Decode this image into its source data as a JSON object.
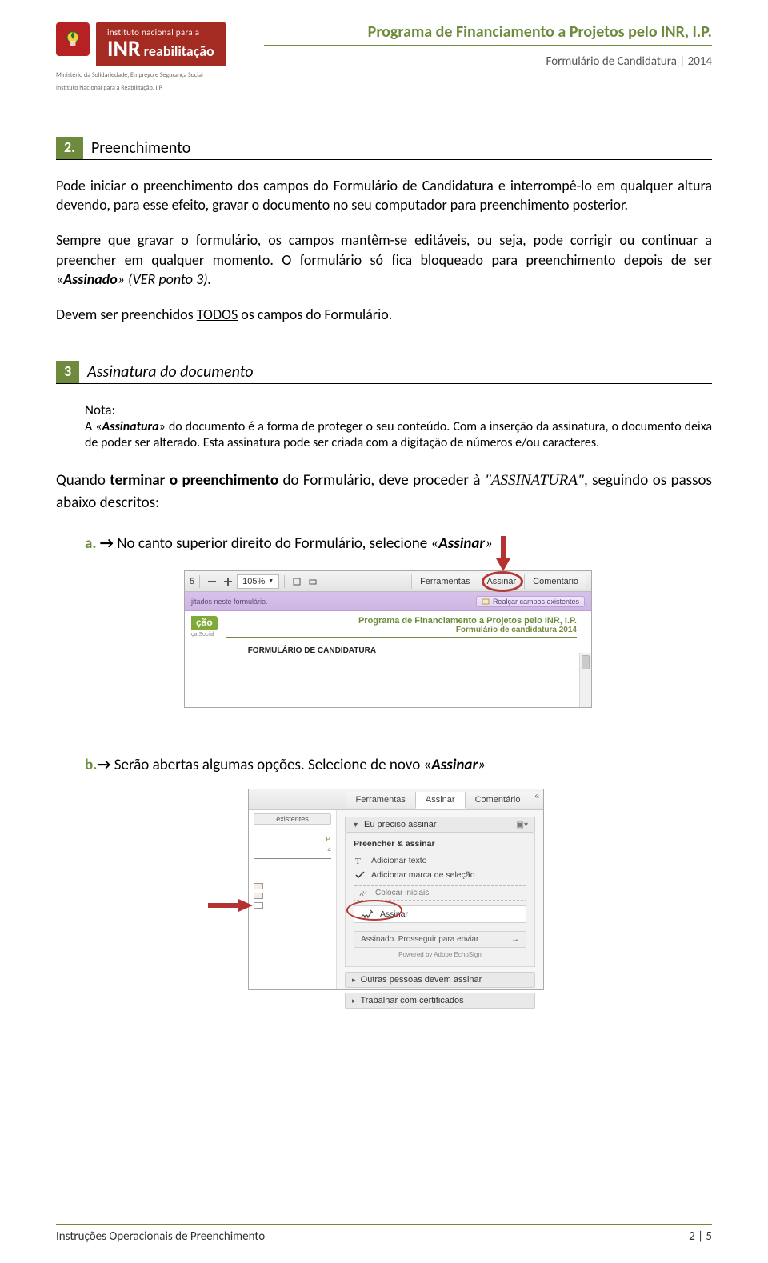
{
  "header": {
    "program_title": "Programa de Financiamento a Projetos pelo INR, I.P.",
    "subtitle": "Formulário de Candidatura | 2014",
    "brand_small": "instituto nacional para a",
    "brand_big": "reabilitação",
    "acronym": "INR",
    "ministry_l1": "Ministério da Solidariedade, Emprego e Segurança Social",
    "ministry_l2": "Instituto Nacional para a Reabilitação, I.P."
  },
  "section2": {
    "num": "2.",
    "title": "Preenchimento",
    "p1_a": "Pode iniciar o preenchimento dos campos do Formulário de Candidatura e interrompê-lo em qualquer altura devendo, para esse efeito, gravar o documento no seu computador para preenchimento posterior.",
    "p2_a": "Sempre que gravar o formulário, os campos mantêm-se editáveis, ou seja, pode corrigir ou continuar a preencher em qualquer momento. O formulário só fica bloqueado para preenchimento depois de ser «",
    "p2_b": "Assinado",
    "p2_c": "» (VER ponto 3).",
    "p3_a": "Devem ser preenchidos ",
    "p3_u": "TODOS",
    "p3_b": " os campos do Formulário."
  },
  "section3": {
    "num": "3",
    "title": "Assinatura do documento",
    "note_label": "Nota:",
    "note_a": "A «",
    "note_b": "Assinatura",
    "note_c": "» do documento é a forma de proteger o seu conteúdo. Com a inserção da assinatura, o documento deixa de poder ser alterado. Esta assinatura pode ser criada com a digitação de números e/ou caracteres.",
    "lead_a": "Quando ",
    "lead_b": "terminar o preenchimento",
    "lead_c": " do Formulário, deve proceder à ",
    "lead_d": "\"ASSINATURA\"",
    "lead_e": ", seguindo os passos abaixo descritos:",
    "stepA_letter": "a.",
    "stepA_arrow": "→",
    "stepA_text_a": " No canto superior direito do Formulário, selecione «",
    "stepA_text_b": "Assinar",
    "stepA_text_c": "»",
    "stepB_letter": "b.",
    "stepB_arrow": "→",
    "stepB_text_a": " Serão abertas algumas opções. Selecione de novo «",
    "stepB_text_b": "Assinar",
    "stepB_text_c": "»"
  },
  "shotA": {
    "page_num": "5",
    "zoom": "105%",
    "tab1": "Ferramentas",
    "tab2": "Assinar",
    "tab3": "Comentário",
    "banner_left": "jitados neste formulário.",
    "banner_btn": "Realçar campos existentes",
    "badge": "ção",
    "badge_sub": "ça Social",
    "prog_l1": "Programa de Financiamento a Projetos pelo INR, I.P.",
    "prog_l2": "Formulário de candidatura 2014",
    "form_title": "FORMULÁRIO DE CANDIDATURA"
  },
  "shotB": {
    "tab1": "Ferramentas",
    "tab2": "Assinar",
    "tab3": "Comentário",
    "left_chip": "existentes",
    "left_g1": "P.",
    "left_g2": "4",
    "acc1": "Eu preciso assinar",
    "subhead": "Preencher & assinar",
    "opt1": "Adicionar texto",
    "opt2": "Adicionar marca de seleção",
    "opt3": "Colocar iniciais",
    "opt4": "Assinar",
    "send": "Assinado. Prosseguir para enviar",
    "powered": "Powered by Adobe EchoSign",
    "acc2": "Outras pessoas devem assinar",
    "acc3": "Trabalhar com certificados"
  },
  "footer": {
    "left": "Instruções Operacionais de Preenchimento",
    "right": "2 | 5"
  }
}
